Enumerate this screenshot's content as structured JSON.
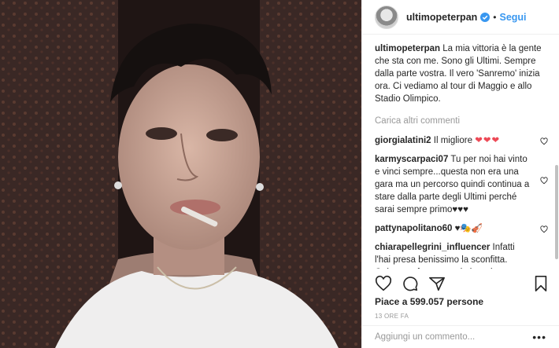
{
  "post": {
    "username": "ultimopeterpan",
    "follow_label": "Segui",
    "dot": "•",
    "caption_user": "ultimopeterpan",
    "caption_text": " La mia vittoria è la gente che sta con me. Sono gli Ultimi. Sempre dalla parte vostra. Il vero 'Sanremo' inizia ora. Ci vediamo al tour di Maggio e allo Stadio Olimpico.",
    "load_more": "Carica altri commenti",
    "comments": [
      {
        "user": "giorgialatini2",
        "text": " Il migliore",
        "emoji": "❤❤❤"
      },
      {
        "user": "karmyscarpaci07",
        "text": " Tu per noi hai vinto e vinci sempre...questa non era una gara ma un percorso quindi continua a stare dalla parte degli Ultimi perché sarai sempre primo",
        "emoji": "♥♥♥"
      },
      {
        "user": "pattynapolitano60",
        "text": " ♥🎭🎻",
        "emoji": ""
      },
      {
        "user": "chiarapellegrini_influencer",
        "text": " Infatti l'hai presa benissimo la sconfitta. Ottima performance da boro in conferenza stampa. Torna a zappare l'orto a San Basilio. Rinforza la voce anzi trova la voce e i testi. Sanremo ci sono",
        "emoji": ""
      }
    ],
    "likes": "Piace a 599.057 persone",
    "time": "13 ORE FA",
    "add_comment_placeholder": "Aggiungi un commento...",
    "more_dots": "•••"
  },
  "icons": {
    "like": "heart-icon",
    "comment": "comment-icon",
    "share": "share-icon",
    "save": "bookmark-icon",
    "verified": "verified-badge-icon"
  },
  "colors": {
    "accent": "#3897f0",
    "text": "#262626",
    "muted": "#999999",
    "heart_red": "#ed4956"
  }
}
